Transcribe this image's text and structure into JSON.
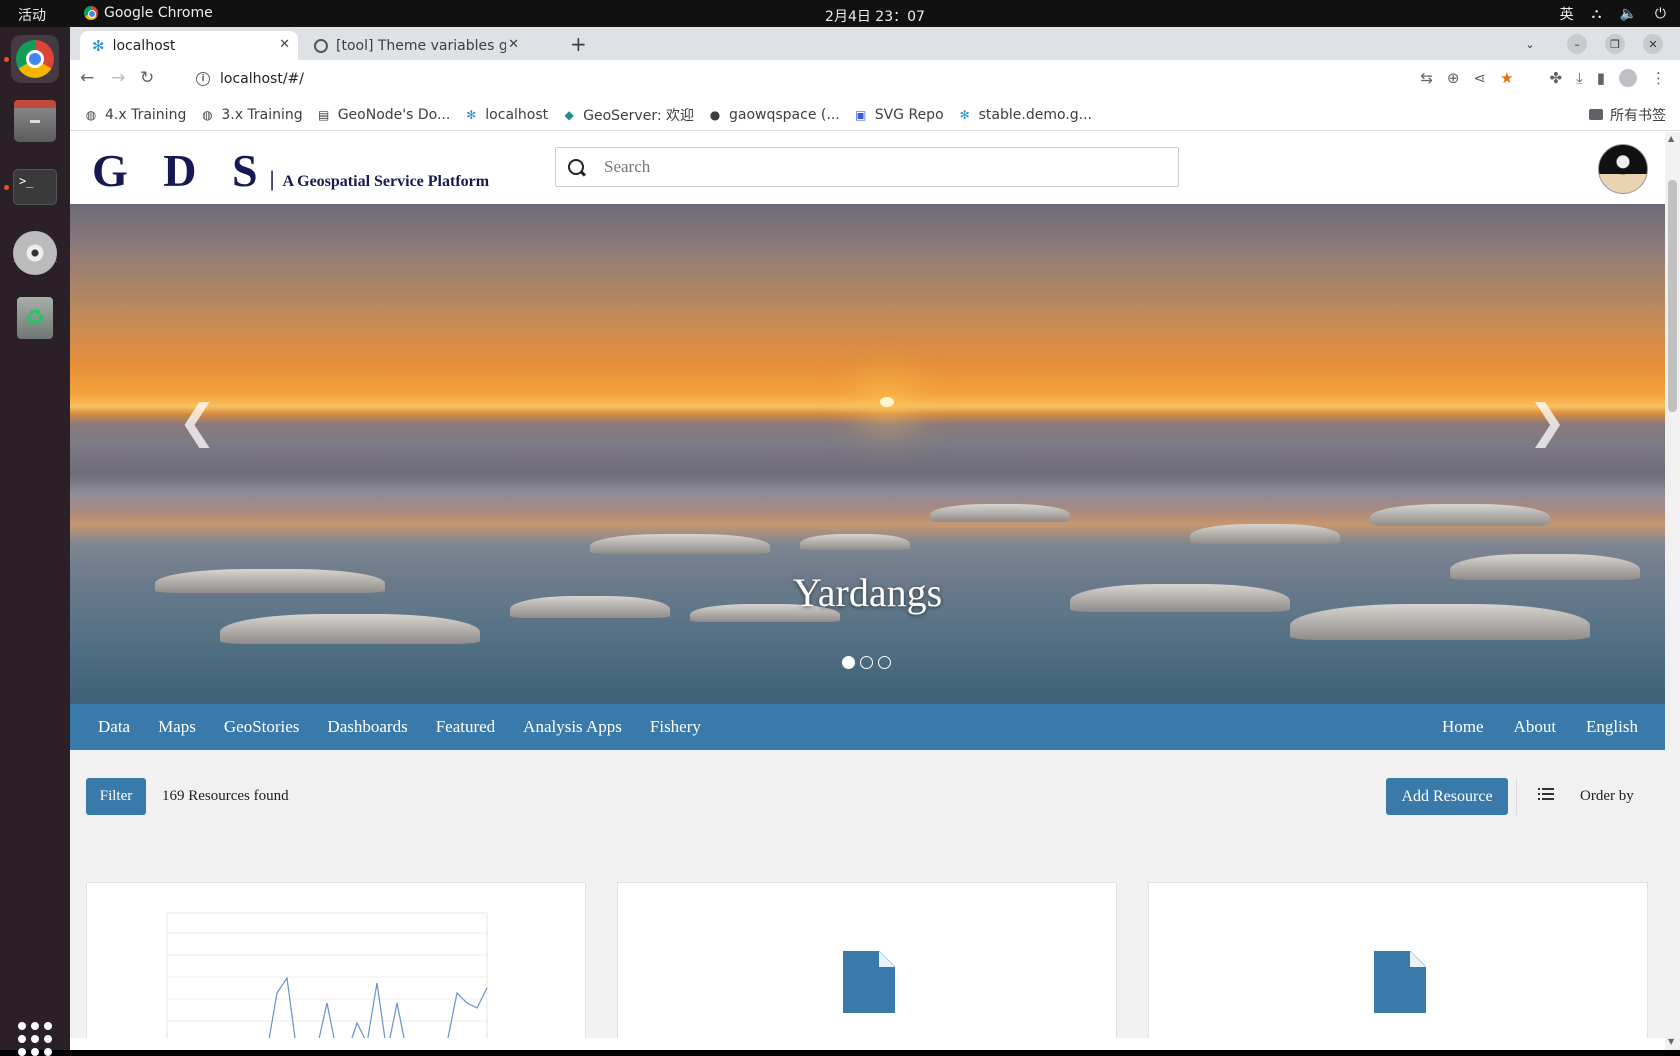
{
  "system": {
    "activities": "活动",
    "app_name": "Google Chrome",
    "clock": "2月4日  23：07",
    "input_method": "英"
  },
  "browser": {
    "tabs": [
      {
        "title": "localhost",
        "active": true
      },
      {
        "title": "[tool] Theme variables ge",
        "active": false
      }
    ],
    "url": "localhost/#/",
    "bookmarks": [
      {
        "label": "4.x Training",
        "icon": "globe-icon"
      },
      {
        "label": "3.x Training",
        "icon": "globe-icon"
      },
      {
        "label": "GeoNode's Do...",
        "icon": "doc-icon"
      },
      {
        "label": "localhost",
        "icon": "geonode-icon"
      },
      {
        "label": "GeoServer: 欢迎",
        "icon": "geoserver-icon"
      },
      {
        "label": "gaowqspace (...",
        "icon": "github-icon"
      },
      {
        "label": "SVG Repo",
        "icon": "svgrepo-icon"
      },
      {
        "label": "stable.demo.g...",
        "icon": "geonode-icon"
      }
    ],
    "all_bookmarks": "所有书签"
  },
  "site": {
    "logo_letters": "G D S",
    "logo_bar": "|",
    "tagline": "A Geospatial Service Platform",
    "search_placeholder": "Search",
    "hero": {
      "caption": "Yardangs",
      "slide_count": 3,
      "active_slide": 1,
      "prev_arrow": "❮",
      "next_arrow": "❯"
    },
    "nav_left": [
      "Data",
      "Maps",
      "GeoStories",
      "Dashboards",
      "Featured",
      "Analysis Apps",
      "Fishery"
    ],
    "nav_right": [
      "Home",
      "About",
      "English"
    ],
    "filter_label": "Filter",
    "resources_found": "169 Resources found",
    "add_resource": "Add Resource",
    "order_by": "Order by",
    "accent_color": "#397aab"
  }
}
